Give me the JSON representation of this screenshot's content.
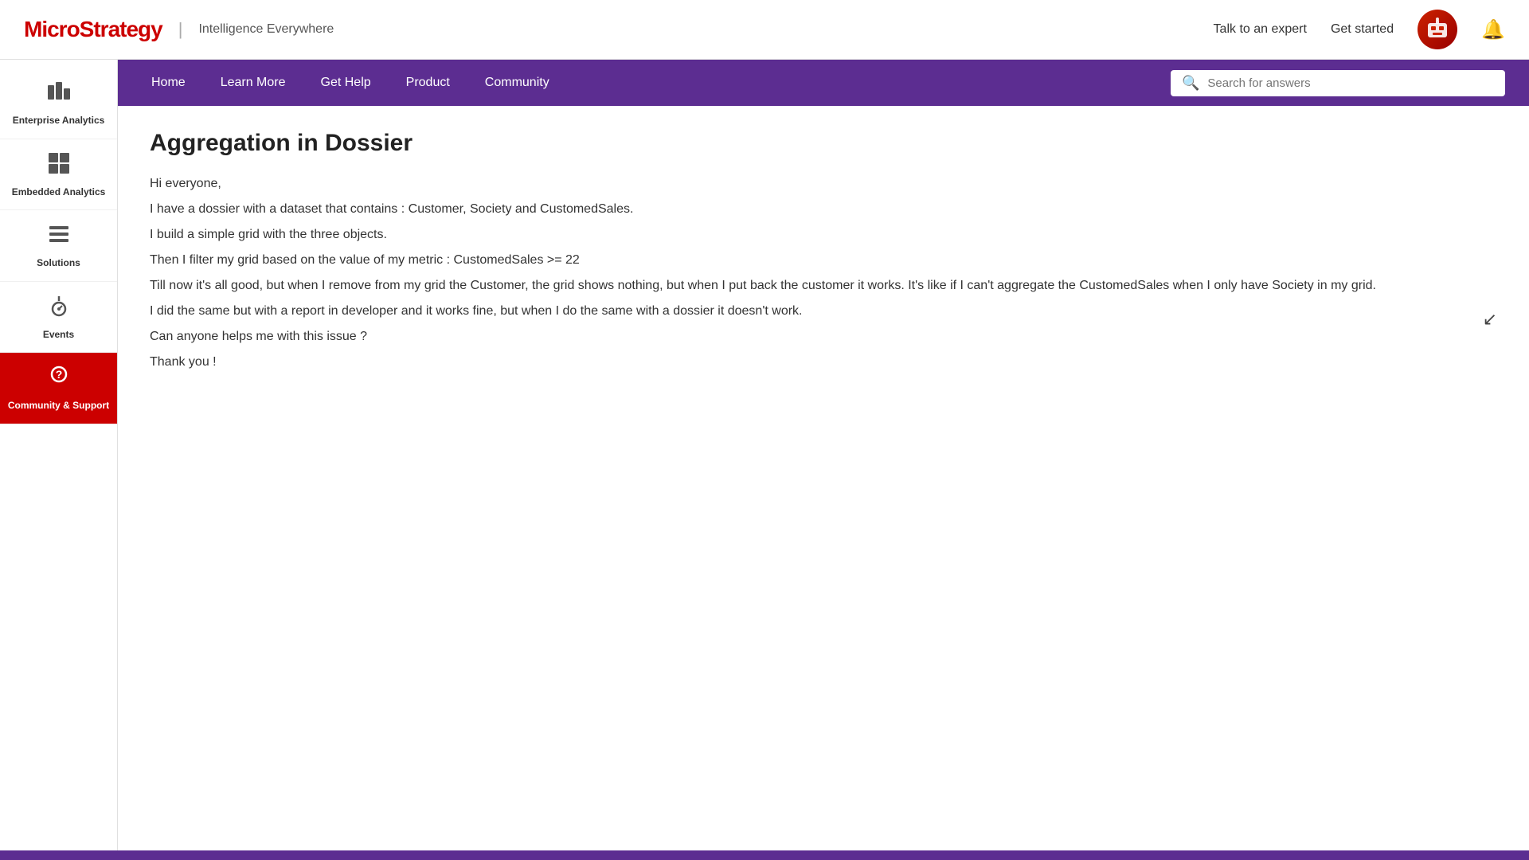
{
  "header": {
    "logo_text": "MicroStrategy",
    "logo_divider": "|",
    "tagline": "Intelligence Everywhere",
    "talk_to_expert": "Talk to an expert",
    "get_started": "Get started"
  },
  "sidebar": {
    "items": [
      {
        "id": "enterprise-analytics",
        "label": "Enterprise Analytics",
        "icon": "▦",
        "active": false
      },
      {
        "id": "embedded-analytics",
        "label": "Embedded Analytics",
        "icon": "⊞",
        "active": false
      },
      {
        "id": "solutions",
        "label": "Solutions",
        "icon": "⊟",
        "active": false
      },
      {
        "id": "events",
        "label": "Events",
        "icon": "🎙",
        "active": false
      },
      {
        "id": "community-support",
        "label": "Community & Support",
        "icon": "?",
        "active": true
      }
    ]
  },
  "navbar": {
    "items": [
      {
        "id": "home",
        "label": "Home"
      },
      {
        "id": "learn-more",
        "label": "Learn More"
      },
      {
        "id": "get-help",
        "label": "Get Help"
      },
      {
        "id": "product",
        "label": "Product"
      },
      {
        "id": "community",
        "label": "Community"
      }
    ],
    "search_placeholder": "Search for answers"
  },
  "post": {
    "title": "Aggregation in Dossier",
    "body_lines": [
      "Hi everyone,",
      "I have a dossier with a dataset that contains : Customer, Society and CustomedSales.",
      "I build a simple grid with the three objects.",
      "Then I filter my grid based on the value of my metric : CustomedSales >= 22",
      "Till now it's all good, but when I remove from my grid the Customer, the grid shows nothing, but when I put back the customer it works. It's like if I can't aggregate the CustomedSales when I only have Society in my grid.",
      "I did the same but with a report in developer and it works fine, but when I do the same with a dossier it doesn't work.",
      "Can anyone helps me with this issue ?",
      "Thank you !"
    ]
  }
}
